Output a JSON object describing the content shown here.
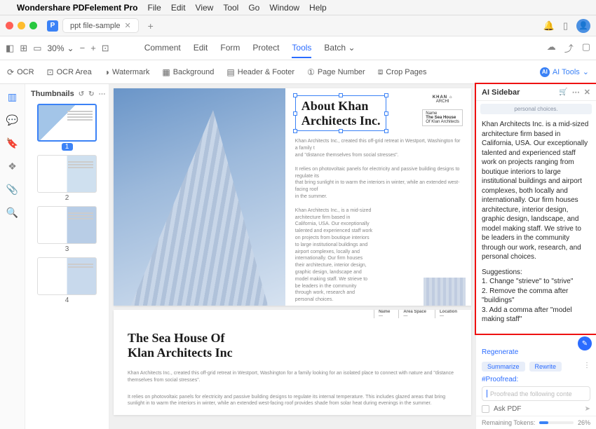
{
  "menubar": {
    "apple": "",
    "appname": "Wondershare PDFelement Pro",
    "items": [
      "File",
      "Edit",
      "View",
      "Tool",
      "Go",
      "Window",
      "Help"
    ]
  },
  "tabbar": {
    "tab_title": "ppt file-sample",
    "plus": "+"
  },
  "toolbar": {
    "zoom": "30%",
    "tabs": [
      "Comment",
      "Edit",
      "Form",
      "Protect",
      "Tools",
      "Batch"
    ],
    "active_tab": "Tools"
  },
  "toolrow": {
    "items": [
      "OCR",
      "OCR Area",
      "Watermark",
      "Background",
      "Header & Footer",
      "Page Number",
      "Crop Pages"
    ],
    "ai": "AI Tools"
  },
  "thumbs": {
    "title": "Thumbnails",
    "nums": [
      "1",
      "2",
      "3",
      "4"
    ]
  },
  "page1": {
    "title_l1": "About Khan",
    "title_l2": "Architects Inc.",
    "logo1": "KHAN",
    "logo1b": "ARCHI",
    "logo2a": "Name",
    "logo2b": "The Sea House",
    "logo2c": "Of Klan Architects",
    "p1": "Khan Architects Inc., created this off-grid retreat in Westport, Washington for a family t",
    "p2": "and \"distance themselves from social stresses\".",
    "p3": "It relies on photovoltaic panels for electricity and passive building designs to regulate its",
    "p4": "that bring sunlight in to warm the interiors in winter, while an extended west-facing roof",
    "p5": "in the summer.",
    "col2": "Khan Architects Inc., is a mid-sized architecture firm based in California, USA. Our exceptionally talented and experienced staff work on projects from boutique interiors to large institutional buildings and airport complexes, locally and internationally. Our firm houses their architecture, interior design, graphic design, landscape and model making staff. We strieve to be leaders in the community through work, research and personal choices."
  },
  "page2": {
    "title_l1": "The Sea House Of",
    "title_l2": "Klan Architects Inc",
    "h1": "Name",
    "h2": "Area Space",
    "h3": "Location",
    "p1": "Khan Architects Inc., created this off-grid retreat in Westport, Washington for a family looking for an isolated place to connect with nature and \"distance themselves from social stresses\".",
    "p2": "It relies on photovoltaic panels for electricity and passive building designs to regulate its internal temperature. This includes glazed areas that bring sunlight in to warm the interiors in winter, while an extended west-facing roof provides shade from solar heat during evenings in the summer."
  },
  "ai": {
    "title": "AI Sidebar",
    "snippet": "personal choices.",
    "body": "Khan Architects Inc. is a mid-sized architecture firm based in California, USA. Our exceptionally talented and experienced staff work on projects ranging from boutique interiors to large institutional buildings and airport complexes, both locally and internationally. Our firm houses architecture, interior design, graphic design, landscape, and model making staff. We strive to be leaders in the community through our work, research, and personal choices.",
    "sugg_head": "Suggestions:",
    "sugg1": "1. Change \"strieve\" to \"strive\"",
    "sugg2": "2. Remove the comma after \"buildings\"",
    "sugg3": "3. Add a comma after \"model making staff\"",
    "regenerate": "Regenerate",
    "chip1": "Summarize",
    "chip2": "Rewrite",
    "proof": "#Proofread:",
    "placeholder": "Proofread the following conte",
    "ask": "Ask PDF",
    "tokens_label": "Remaining Tokens:",
    "tokens_pct": "26%"
  }
}
